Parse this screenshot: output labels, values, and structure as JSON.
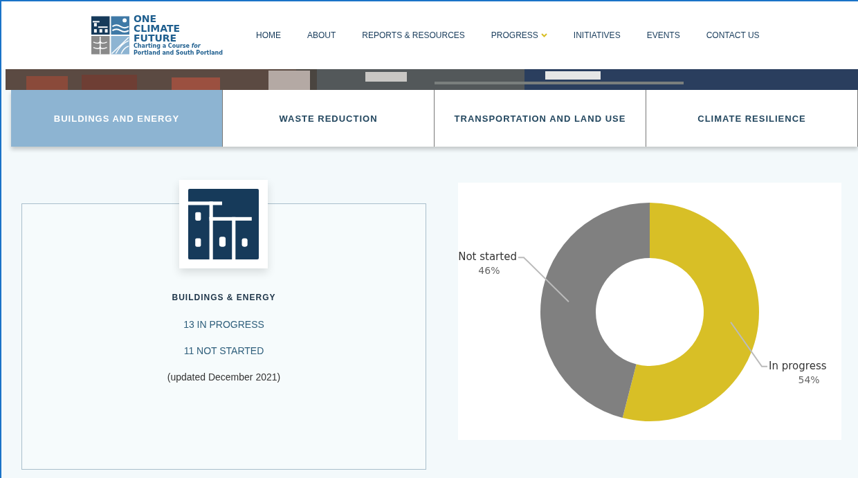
{
  "logo": {
    "lines": [
      "ONE",
      "CLIMATE",
      "FUTURE"
    ],
    "tagline": [
      "Charting a Course *for*",
      "Portland and South Portland"
    ]
  },
  "nav": [
    {
      "label": "HOME",
      "dropdown": false
    },
    {
      "label": "ABOUT",
      "dropdown": false
    },
    {
      "label": "REPORTS & RESOURCES",
      "dropdown": false
    },
    {
      "label": "PROGRESS",
      "dropdown": true
    },
    {
      "label": "INITIATIVES",
      "dropdown": false
    },
    {
      "label": "EVENTS",
      "dropdown": false
    },
    {
      "label": "CONTACT US",
      "dropdown": false
    }
  ],
  "tabs": [
    {
      "label": "BUILDINGS AND ENERGY",
      "selected": true
    },
    {
      "label": "WASTE REDUCTION",
      "selected": false
    },
    {
      "label": "TRANSPORTATION AND LAND USE",
      "selected": false
    },
    {
      "label": "CLIMATE RESILIENCE",
      "selected": false
    }
  ],
  "card": {
    "title": "BUILDINGS & ENERGY",
    "stats": [
      "13 IN PROGRESS",
      "11 NOT STARTED"
    ],
    "note": "(updated December 2021)"
  },
  "chart": {
    "chart_data": {
      "type": "donut",
      "categories": [
        "In progress",
        "Not started"
      ],
      "values": [
        54,
        46
      ],
      "colors": [
        "#d8bf26",
        "#808080"
      ],
      "value_labels": [
        "54%",
        "46%"
      ]
    }
  }
}
